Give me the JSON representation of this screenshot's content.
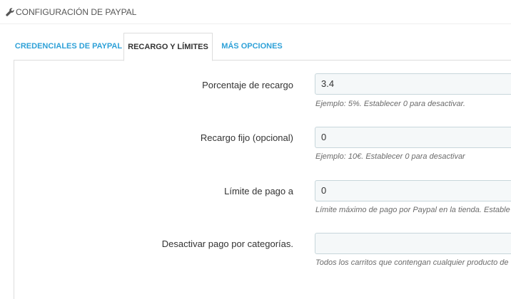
{
  "panel": {
    "title": "CONFIGURACIÓN DE PAYPAL",
    "icon": "wrench-icon"
  },
  "tabs": [
    {
      "label": "CREDENCIALES DE PAYPAL",
      "active": false
    },
    {
      "label": "RECARGO Y LÍMITES",
      "active": true
    },
    {
      "label": "MÁS OPCIONES",
      "active": false
    }
  ],
  "form": {
    "fields": [
      {
        "label": "Porcentaje de recargo",
        "value": "3.4",
        "help": "Ejemplo: 5%. Establecer 0 para desactivar."
      },
      {
        "label": "Recargo fijo (opcional)",
        "value": "0",
        "help": "Ejemplo: 10€. Establecer 0 para desactivar"
      },
      {
        "label": "Límite de pago a",
        "value": "0",
        "help": "Límite máximo de pago por Paypal en la tienda. Estable"
      },
      {
        "label": "Desactivar pago por categorías.",
        "value": "",
        "help": "Todos los carritos que contengan cualquier producto de"
      }
    ]
  },
  "colors": {
    "tab_link": "#2ea1d8",
    "input_bg": "#f5f8f9",
    "input_border": "#c7d6db"
  }
}
